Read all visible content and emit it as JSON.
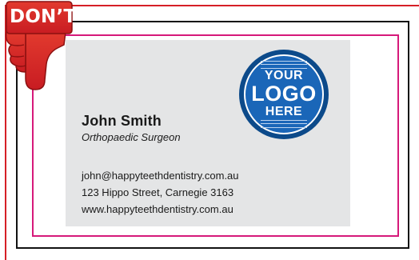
{
  "badge": {
    "label": "DON’T",
    "icon": "thumbs-down-icon",
    "color": "#d61f26"
  },
  "card": {
    "name": "John Smith",
    "title": "Orthopaedic Surgeon",
    "email": "john@happyteethdentistry.com.au",
    "address": "123 Hippo Street, Carnegie 3163",
    "website": "www.happyteethdentistry.com.au",
    "background": "#e4e5e6"
  },
  "logo": {
    "line1": "YOUR",
    "line2": "LOGO",
    "line3": "HERE",
    "color": "#1a66b8"
  },
  "guides": {
    "bleed_color": "#d61f26",
    "trim_color": "#111111",
    "safe_color": "#d6197a"
  }
}
